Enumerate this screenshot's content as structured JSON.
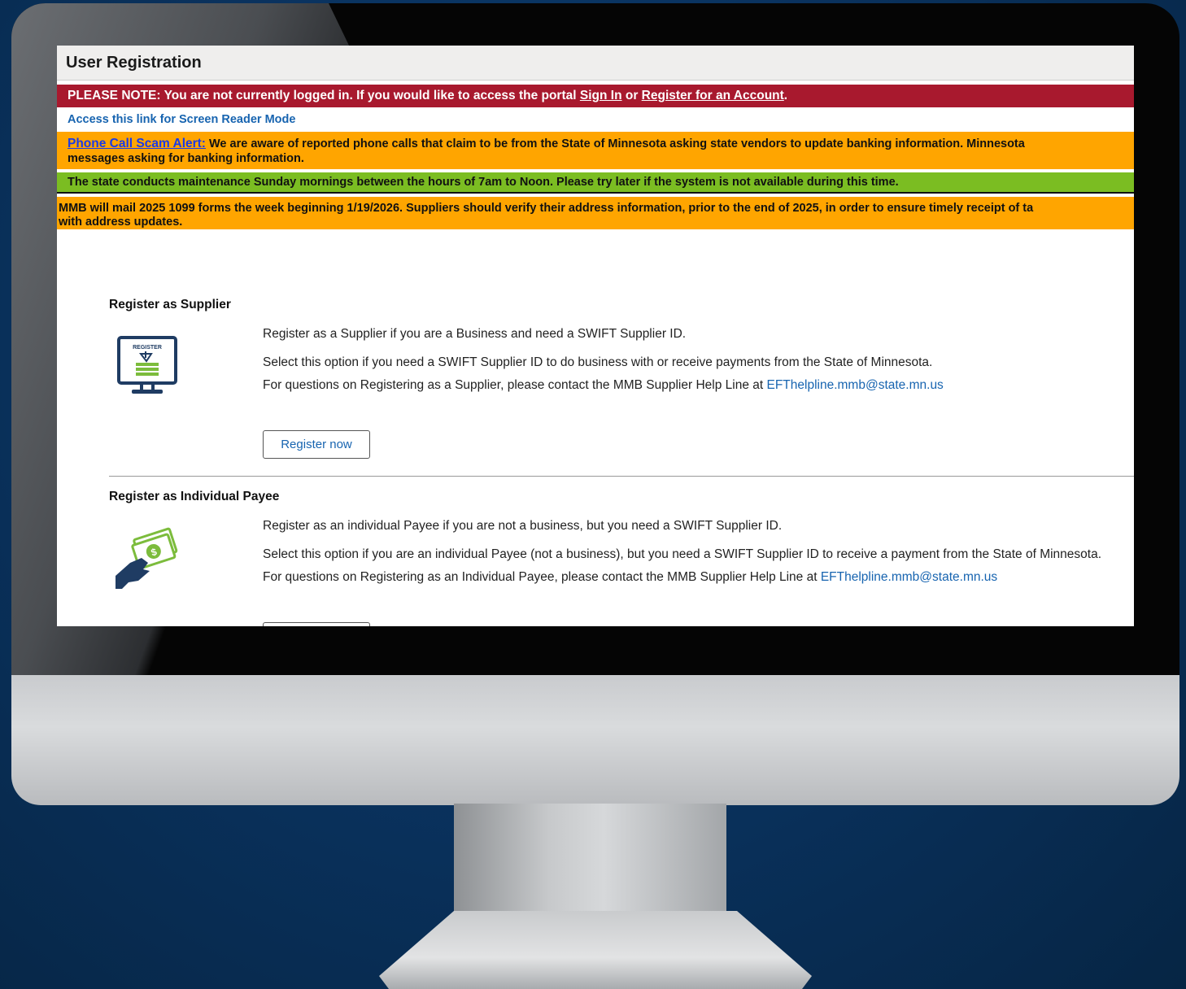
{
  "page": {
    "title": "User Registration"
  },
  "alerts": {
    "login_note_prefix": "PLEASE NOTE:  You are not currently logged in.  If you would like to access the portal ",
    "sign_in": "Sign In",
    "or": " or ",
    "register_account": "Register for an Account",
    "period": ".",
    "screen_reader_link": "Access this link for Screen Reader Mode",
    "scam_link": "Phone Call Scam Alert:",
    "scam_text_line1": " We are aware of reported phone calls that claim to be from the State of Minnesota asking state vendors to update banking information. Minnesota",
    "scam_text_line2": "messages asking for banking information.",
    "maintenance": "The state conducts maintenance Sunday mornings between the hours of 7am to Noon.  Please try later if the system is not available during this time.",
    "forms_line1": "MMB will mail 2025 1099 forms the week beginning 1/19/2026. Suppliers should verify their address information, prior to the end of 2025, in order to ensure timely receipt of ta",
    "forms_line2": "with address updates."
  },
  "supplier": {
    "heading": "Register as Supplier",
    "icon": "register-monitor-icon",
    "icon_text": "REGISTER",
    "line1": "Register as a Supplier if you are a Business and need a SWIFT Supplier ID.",
    "line2": "Select this option if you need a SWIFT Supplier ID to do business with or receive payments from the State of Minnesota.",
    "line3_prefix": "For questions on Registering as a Supplier, please contact the MMB Supplier Help Line at ",
    "email": "EFThelpline.mmb@state.mn.us",
    "button": "Register now"
  },
  "payee": {
    "heading": "Register as Individual Payee",
    "icon": "hand-money-icon",
    "line1": "Register as an individual Payee if you are not a business, but you need a SWIFT Supplier ID.",
    "line2": "Select this option if you are an individual Payee (not a business), but you need a SWIFT Supplier ID to receive a payment from the State of Minnesota.",
    "line3_prefix": "For questions on Registering as an Individual Payee, please contact the MMB Supplier Help Line at ",
    "email": "EFThelpline.mmb@state.mn.us"
  },
  "colors": {
    "red_bar": "#a8192e",
    "orange_bar": "#ffa500",
    "green_bar": "#7bbd22",
    "link": "#1764b0",
    "icon_navy": "#1f3c63",
    "icon_green": "#7cbc3c"
  }
}
